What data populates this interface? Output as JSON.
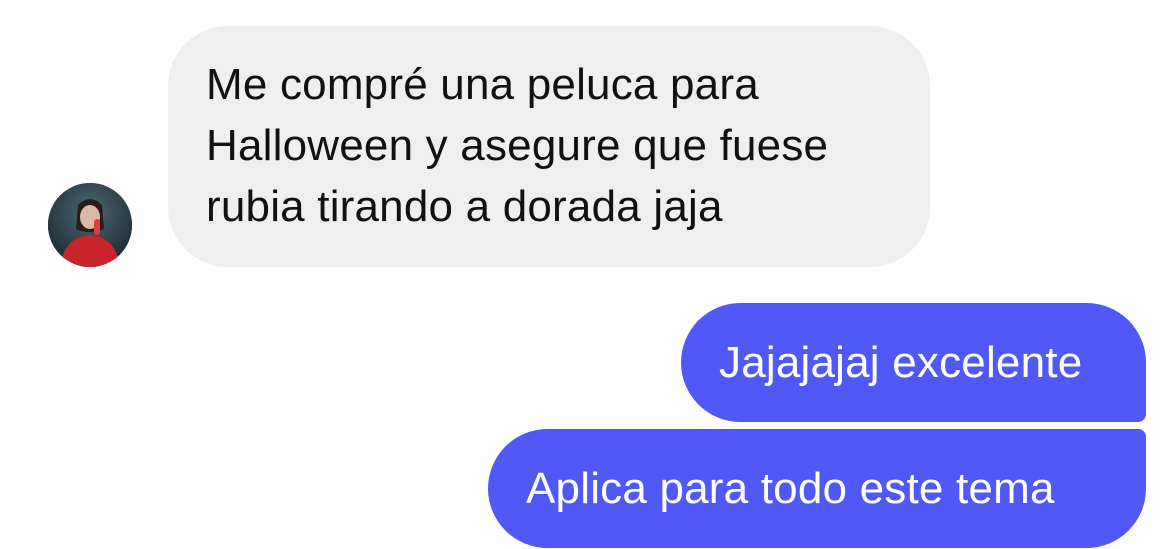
{
  "conversation": {
    "incoming": {
      "lines": [
        "Me compré una peluca para",
        "Halloween y asegure que fuese",
        "rubia tirando a dorada jaja"
      ]
    },
    "outgoing": [
      {
        "text": "Jajajajaj excelente"
      },
      {
        "text": "Aplica para todo este tema"
      }
    ]
  },
  "colors": {
    "incoming_bubble": "#efefef",
    "outgoing_bubble": "#5058f5",
    "incoming_text": "#111111",
    "outgoing_text": "#ffffff"
  },
  "icons": {
    "avatar": "contact-avatar-photo"
  }
}
